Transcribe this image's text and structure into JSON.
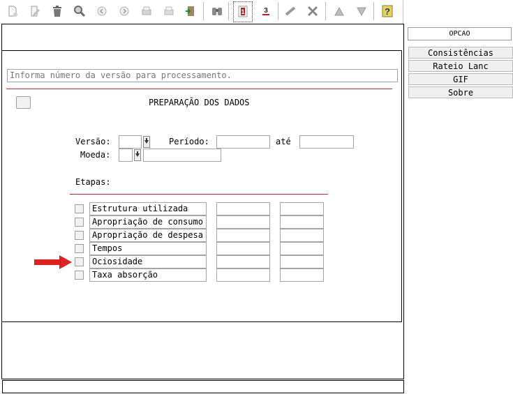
{
  "toolbar": {
    "icons": [
      "new-icon",
      "edit-icon",
      "delete-icon",
      "search-icon",
      "prev-icon",
      "next-icon",
      "print-icon",
      "print-preview-icon",
      "exit-icon",
      "binoculars-icon",
      "info-icon",
      "calendar-icon",
      "check-icon",
      "tools-icon",
      "up-icon",
      "down-icon",
      "help-icon"
    ]
  },
  "side": {
    "opcao": "OPCAO",
    "buttons": [
      "Consistências",
      "Rateio Lanc",
      "GIF",
      "Sobre"
    ]
  },
  "form": {
    "hint": "Informa número da versão para processamento.",
    "title": "PREPARAÇÃO DOS DADOS",
    "versao_label": "Versão:",
    "periodo_label": "Período:",
    "ate_label": "até",
    "moeda_label": "Moeda:",
    "etapas_label": "Etapas:",
    "etapas": [
      "Estrutura utilizada",
      "Apropriação de consumo",
      "Apropriação de despesa",
      "Tempos",
      "Ociosidade",
      "Taxa absorção"
    ]
  },
  "colors": {
    "divider": "#cc2222",
    "arrow": "#e02020"
  }
}
